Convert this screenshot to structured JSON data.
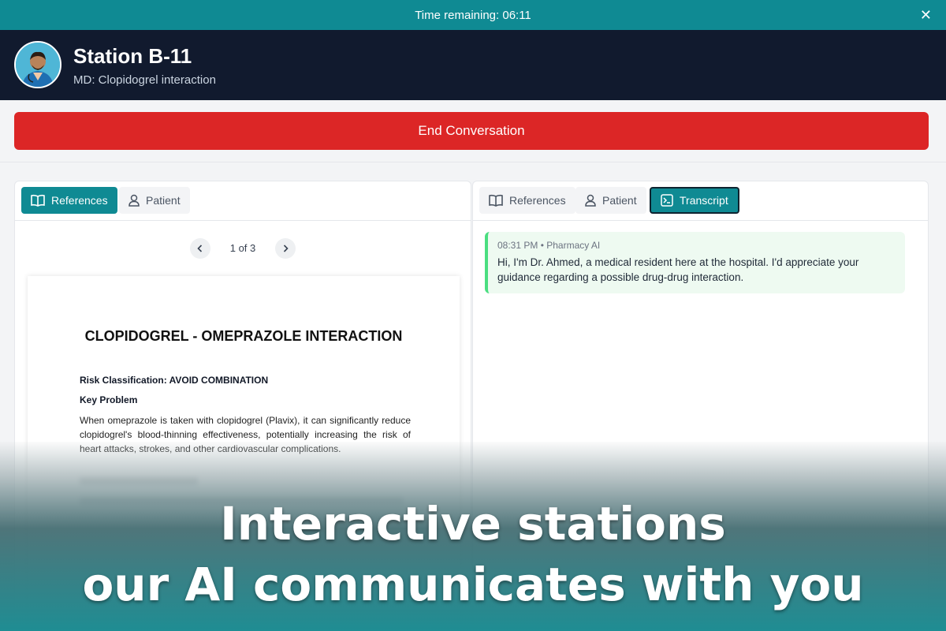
{
  "timer": {
    "label": "Time remaining: 06:11",
    "close_icon": "close-icon"
  },
  "header": {
    "title": "Station B-11",
    "subtitle": "MD: Clopidogrel interaction",
    "avatar": "doctor-avatar"
  },
  "end_button": {
    "label": "End Conversation"
  },
  "left_panel": {
    "tabs": [
      {
        "label": "References",
        "icon": "book-icon",
        "active": true
      },
      {
        "label": "Patient",
        "icon": "user-icon",
        "active": false
      }
    ],
    "pager": {
      "label": "1 of 3"
    },
    "document": {
      "title": "CLOPIDOGREL - OMEPRAZOLE INTERACTION",
      "risk": "Risk Classification: AVOID COMBINATION",
      "key_heading": "Key Problem",
      "body": "When omeprazole is taken with clopidogrel (Plavix), it can significantly reduce clopidogrel's blood-thinning effectiveness, potentially increasing the risk of heart attacks, strokes, and other cardiovascular complications."
    }
  },
  "right_panel": {
    "tabs": [
      {
        "label": "References",
        "icon": "book-icon",
        "active": false
      },
      {
        "label": "Patient",
        "icon": "user-icon",
        "active": false
      },
      {
        "label": "Transcript",
        "icon": "terminal-icon",
        "active": true
      }
    ],
    "message": {
      "meta": "08:31 PM • Pharmacy AI",
      "text": "Hi, I'm Dr. Ahmed, a medical resident here at the hospital. I'd appreciate your guidance regarding a possible drug-drug interaction."
    }
  },
  "overlay": {
    "line1": "Interactive stations",
    "line2": "our AI communicates with you"
  },
  "colors": {
    "teal": "#0f8a93",
    "navy": "#111a2e",
    "red": "#dc2626",
    "green": "#4ade80"
  }
}
